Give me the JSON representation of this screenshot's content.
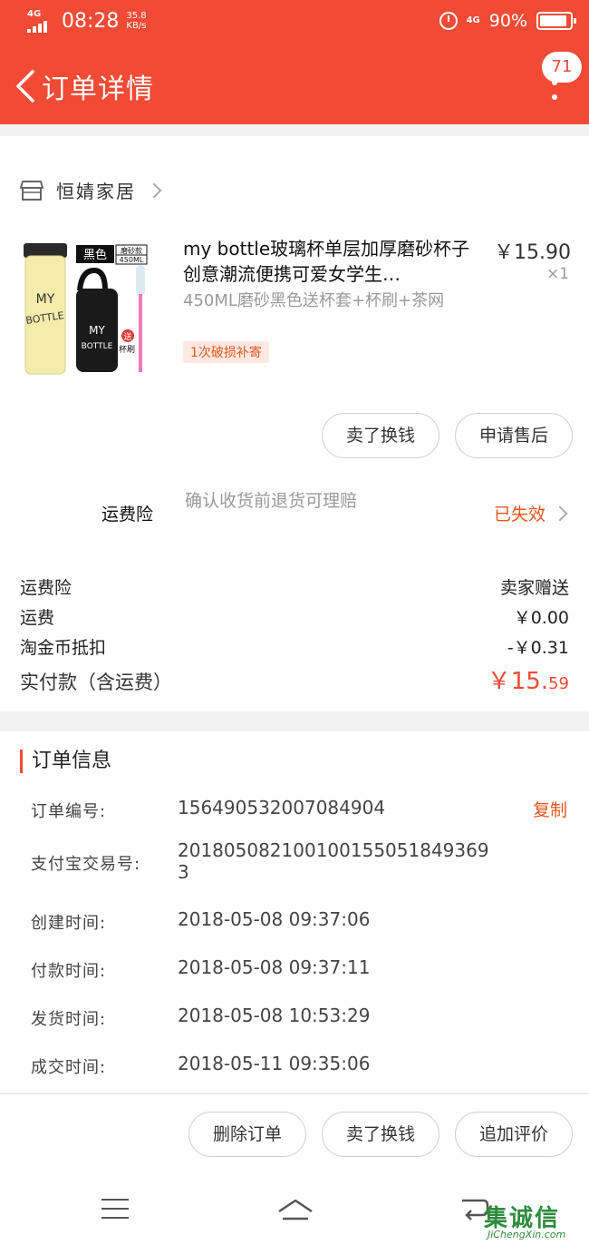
{
  "status_bar": {
    "network": "4G",
    "time": "08:28",
    "speed_value": "35.8",
    "speed_unit": "KB/s",
    "net_type": "4G",
    "battery": "90%",
    "battery_level": 0.9
  },
  "header": {
    "title": "订单详情",
    "message_count": "71"
  },
  "shop": {
    "name": "恒婧家居"
  },
  "product": {
    "title": "my bottle玻璃杯单层加厚磨砂杯子创意潮流便携可爱女学生…",
    "price": "￥15.90",
    "quantity": "×1",
    "sku": "450ML磨砂黑色送杯套+杯刷+茶网",
    "tag": "1次破损补寄",
    "image_text": {
      "brand_line1": "MY",
      "brand_line2": "BOTTLE",
      "color_badge": "黑色",
      "variant_badge": "磨砂款",
      "volume_badge": "450ML",
      "gift_label": "送",
      "brush_label": "杯刷"
    }
  },
  "actions": {
    "sell_label": "卖了换钱",
    "after_sale_label": "申请售后"
  },
  "insurance": {
    "label": "运费险",
    "description": "确认收货前退货可理赔",
    "status": "已失效"
  },
  "fees": {
    "rows": [
      {
        "label": "运费险",
        "value": "卖家赠送"
      },
      {
        "label": "运费",
        "value": "￥0.00"
      },
      {
        "label": "淘金币抵扣",
        "value": "-￥0.31"
      }
    ],
    "paid_label": "实付款（含运费）",
    "paid_main": "￥15.",
    "paid_cents": "59"
  },
  "order_info": {
    "title": "订单信息",
    "copy_label": "复制",
    "rows": [
      {
        "label": "订单编号:",
        "value": "156490532007084904"
      },
      {
        "label": "支付宝交易号:",
        "value": "2018050821001001550518493693"
      },
      {
        "label": "创建时间:",
        "value": "2018-05-08 09:37:06"
      },
      {
        "label": "付款时间:",
        "value": "2018-05-08 09:37:11"
      },
      {
        "label": "发货时间:",
        "value": "2018-05-08 10:53:29"
      },
      {
        "label": "成交时间:",
        "value": "2018-05-11 09:35:06"
      }
    ]
  },
  "bottom_actions": {
    "delete_label": "删除订单",
    "sell_label": "卖了换钱",
    "review_label": "追加评价"
  },
  "watermark": {
    "logo": "集诚信",
    "url": "JiChengXin.com"
  },
  "colors": {
    "brand": "#f14a35",
    "accent_orange": "#e8561e"
  }
}
